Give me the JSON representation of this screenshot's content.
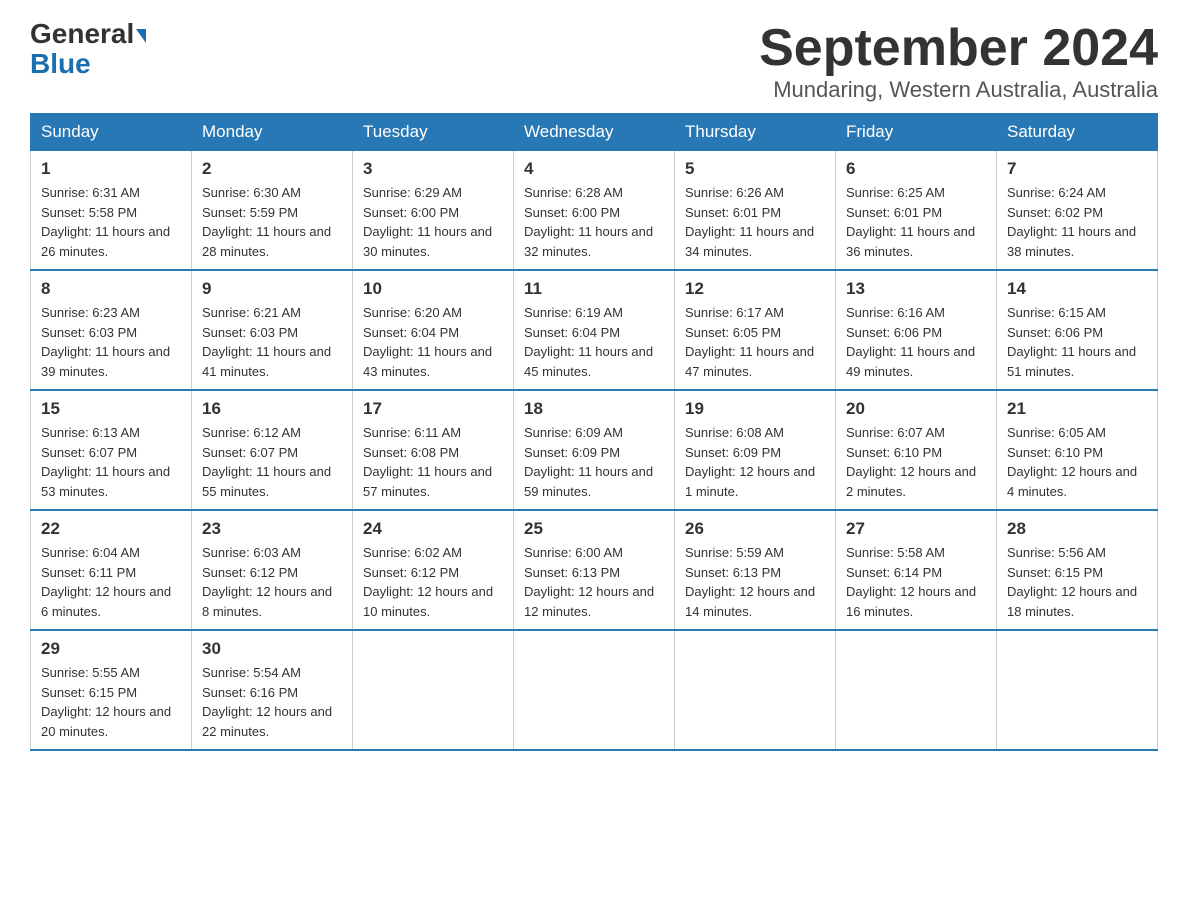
{
  "logo": {
    "line1_normal": "General",
    "line1_triangle": true,
    "line2": "Blue"
  },
  "title": "September 2024",
  "location": "Mundaring, Western Australia, Australia",
  "headers": [
    "Sunday",
    "Monday",
    "Tuesday",
    "Wednesday",
    "Thursday",
    "Friday",
    "Saturday"
  ],
  "weeks": [
    [
      {
        "day": "1",
        "sunrise": "6:31 AM",
        "sunset": "5:58 PM",
        "daylight": "11 hours and 26 minutes."
      },
      {
        "day": "2",
        "sunrise": "6:30 AM",
        "sunset": "5:59 PM",
        "daylight": "11 hours and 28 minutes."
      },
      {
        "day": "3",
        "sunrise": "6:29 AM",
        "sunset": "6:00 PM",
        "daylight": "11 hours and 30 minutes."
      },
      {
        "day": "4",
        "sunrise": "6:28 AM",
        "sunset": "6:00 PM",
        "daylight": "11 hours and 32 minutes."
      },
      {
        "day": "5",
        "sunrise": "6:26 AM",
        "sunset": "6:01 PM",
        "daylight": "11 hours and 34 minutes."
      },
      {
        "day": "6",
        "sunrise": "6:25 AM",
        "sunset": "6:01 PM",
        "daylight": "11 hours and 36 minutes."
      },
      {
        "day": "7",
        "sunrise": "6:24 AM",
        "sunset": "6:02 PM",
        "daylight": "11 hours and 38 minutes."
      }
    ],
    [
      {
        "day": "8",
        "sunrise": "6:23 AM",
        "sunset": "6:03 PM",
        "daylight": "11 hours and 39 minutes."
      },
      {
        "day": "9",
        "sunrise": "6:21 AM",
        "sunset": "6:03 PM",
        "daylight": "11 hours and 41 minutes."
      },
      {
        "day": "10",
        "sunrise": "6:20 AM",
        "sunset": "6:04 PM",
        "daylight": "11 hours and 43 minutes."
      },
      {
        "day": "11",
        "sunrise": "6:19 AM",
        "sunset": "6:04 PM",
        "daylight": "11 hours and 45 minutes."
      },
      {
        "day": "12",
        "sunrise": "6:17 AM",
        "sunset": "6:05 PM",
        "daylight": "11 hours and 47 minutes."
      },
      {
        "day": "13",
        "sunrise": "6:16 AM",
        "sunset": "6:06 PM",
        "daylight": "11 hours and 49 minutes."
      },
      {
        "day": "14",
        "sunrise": "6:15 AM",
        "sunset": "6:06 PM",
        "daylight": "11 hours and 51 minutes."
      }
    ],
    [
      {
        "day": "15",
        "sunrise": "6:13 AM",
        "sunset": "6:07 PM",
        "daylight": "11 hours and 53 minutes."
      },
      {
        "day": "16",
        "sunrise": "6:12 AM",
        "sunset": "6:07 PM",
        "daylight": "11 hours and 55 minutes."
      },
      {
        "day": "17",
        "sunrise": "6:11 AM",
        "sunset": "6:08 PM",
        "daylight": "11 hours and 57 minutes."
      },
      {
        "day": "18",
        "sunrise": "6:09 AM",
        "sunset": "6:09 PM",
        "daylight": "11 hours and 59 minutes."
      },
      {
        "day": "19",
        "sunrise": "6:08 AM",
        "sunset": "6:09 PM",
        "daylight": "12 hours and 1 minute."
      },
      {
        "day": "20",
        "sunrise": "6:07 AM",
        "sunset": "6:10 PM",
        "daylight": "12 hours and 2 minutes."
      },
      {
        "day": "21",
        "sunrise": "6:05 AM",
        "sunset": "6:10 PM",
        "daylight": "12 hours and 4 minutes."
      }
    ],
    [
      {
        "day": "22",
        "sunrise": "6:04 AM",
        "sunset": "6:11 PM",
        "daylight": "12 hours and 6 minutes."
      },
      {
        "day": "23",
        "sunrise": "6:03 AM",
        "sunset": "6:12 PM",
        "daylight": "12 hours and 8 minutes."
      },
      {
        "day": "24",
        "sunrise": "6:02 AM",
        "sunset": "6:12 PM",
        "daylight": "12 hours and 10 minutes."
      },
      {
        "day": "25",
        "sunrise": "6:00 AM",
        "sunset": "6:13 PM",
        "daylight": "12 hours and 12 minutes."
      },
      {
        "day": "26",
        "sunrise": "5:59 AM",
        "sunset": "6:13 PM",
        "daylight": "12 hours and 14 minutes."
      },
      {
        "day": "27",
        "sunrise": "5:58 AM",
        "sunset": "6:14 PM",
        "daylight": "12 hours and 16 minutes."
      },
      {
        "day": "28",
        "sunrise": "5:56 AM",
        "sunset": "6:15 PM",
        "daylight": "12 hours and 18 minutes."
      }
    ],
    [
      {
        "day": "29",
        "sunrise": "5:55 AM",
        "sunset": "6:15 PM",
        "daylight": "12 hours and 20 minutes."
      },
      {
        "day": "30",
        "sunrise": "5:54 AM",
        "sunset": "6:16 PM",
        "daylight": "12 hours and 22 minutes."
      },
      null,
      null,
      null,
      null,
      null
    ]
  ]
}
